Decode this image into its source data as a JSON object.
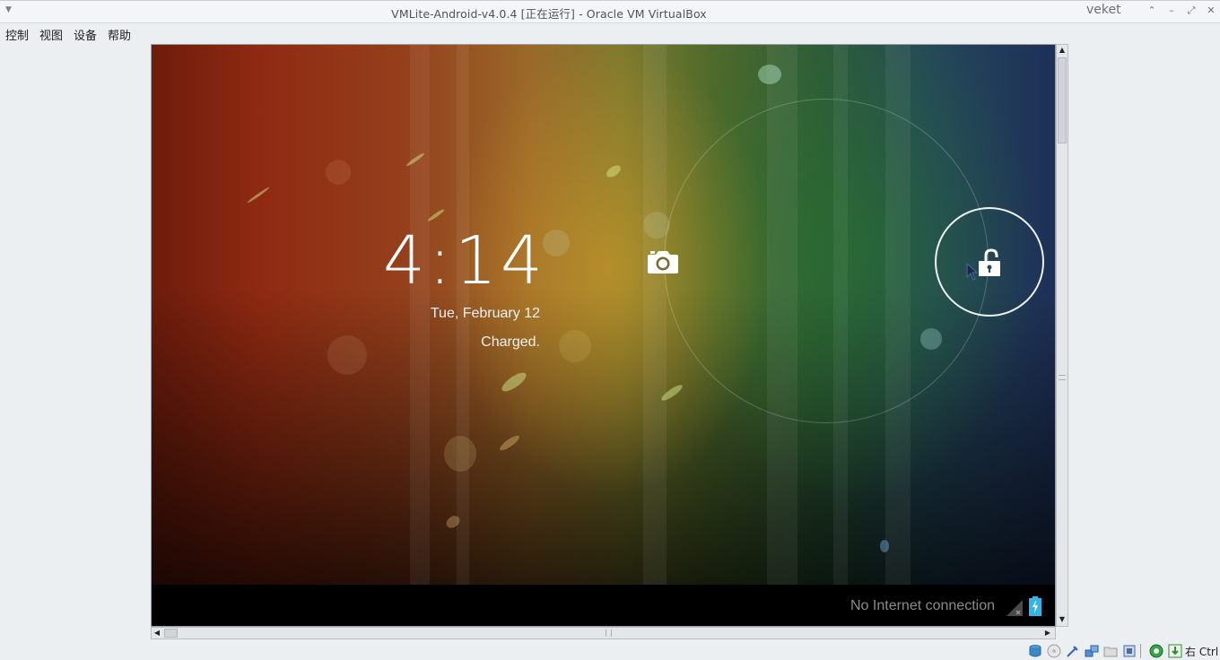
{
  "window": {
    "title": "VMLite-Android-v4.0.4 [正在运行] - Oracle VM VirtualBox",
    "user": "veket",
    "buttons": {
      "up": "⌃",
      "minimize": "–",
      "maximize": "⤢",
      "close": "✕"
    },
    "menu_arrow": "▼"
  },
  "menubar": {
    "items": [
      {
        "label": "控制"
      },
      {
        "label": "视图"
      },
      {
        "label": "设备"
      },
      {
        "label": "帮助"
      }
    ]
  },
  "lockscreen": {
    "time": "4:14",
    "date": "Tue, February 12",
    "battery_status": "Charged.",
    "camera_icon": "camera-icon",
    "unlock_icon": "unlock-padlock-icon"
  },
  "statusbar": {
    "network_message": "No Internet connection",
    "signal_icon": "no-signal-icon",
    "battery_icon": "battery-charging-icon"
  },
  "vbox_status": {
    "host_key": "右 Ctrl",
    "icons": [
      "hard-disk-icon",
      "optical-drive-icon",
      "usb-icon",
      "network-icon",
      "shared-folders-icon",
      "video-capture-icon",
      "virtualization-icon",
      "mouse-integration-icon"
    ]
  },
  "colors": {
    "wall_left": "#8f2a12",
    "wall_mid": "#9a6a2a",
    "wall_green": "#4f6a2c",
    "wall_right": "#1e3058",
    "status_text": "#8b8b8b",
    "battery_blue": "#33b5e5"
  }
}
